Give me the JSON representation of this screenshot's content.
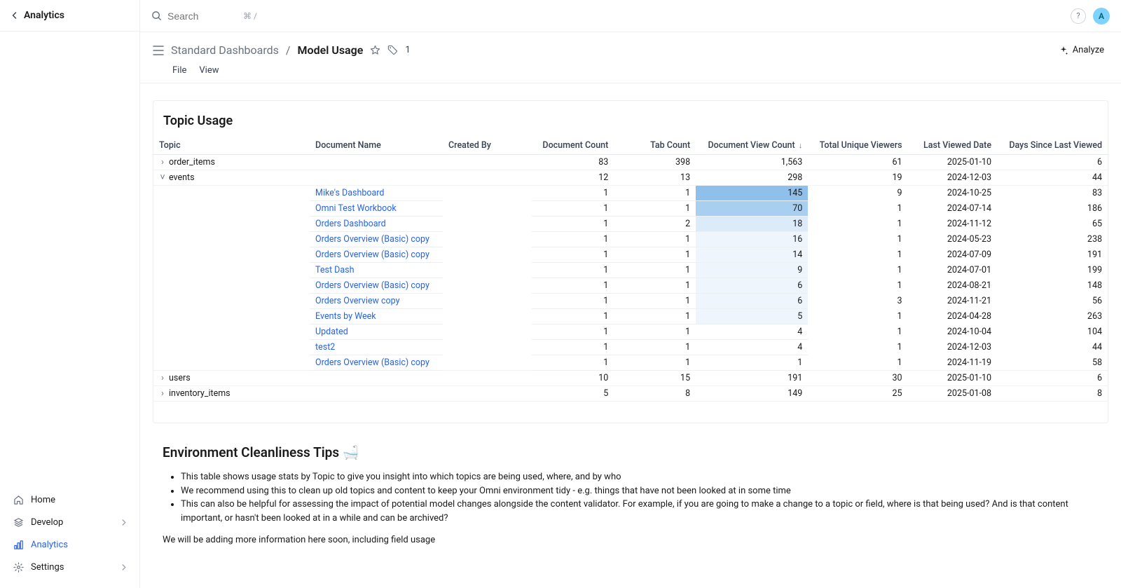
{
  "sidebar": {
    "title": "Analytics",
    "nav": [
      {
        "id": "home",
        "label": "Home",
        "icon": "home-icon"
      },
      {
        "id": "develop",
        "label": "Develop",
        "icon": "layers-icon",
        "chevron": true
      },
      {
        "id": "analytics",
        "label": "Analytics",
        "icon": "bar-chart-icon",
        "active": true
      },
      {
        "id": "settings",
        "label": "Settings",
        "icon": "gear-icon",
        "chevron": true
      }
    ]
  },
  "topbar": {
    "search_placeholder": "Search",
    "kbd": "⌘ /",
    "avatar_initial": "A"
  },
  "header": {
    "breadcrumb_parent": "Standard Dashboards",
    "breadcrumb_current": "Model Usage",
    "tag_count": "1",
    "menu": {
      "file": "File",
      "view": "View"
    },
    "analyze_label": "Analyze"
  },
  "card": {
    "title": "Topic Usage",
    "columns": {
      "topic": "Topic",
      "doc_name": "Document Name",
      "created_by": "Created By",
      "doc_count": "Document Count",
      "tab_count": "Tab Count",
      "view_count": "Document View Count",
      "viewers": "Total Unique Viewers",
      "last_viewed": "Last Viewed Date",
      "days_since": "Days Since Last Viewed"
    },
    "sort_indicator": "↓"
  },
  "chart_data": {
    "type": "table",
    "groups": [
      {
        "topic": "order_items",
        "expanded": false,
        "doc_count": 83,
        "tab_count": 398,
        "view_count": "1,563",
        "viewers": 61,
        "last_viewed": "2025-01-10",
        "days_since": 6
      },
      {
        "topic": "events",
        "expanded": true,
        "doc_count": 12,
        "tab_count": 13,
        "view_count": 298,
        "viewers": 19,
        "last_viewed": "2024-12-03",
        "days_since": 44,
        "rows": [
          {
            "doc": "Mike's Dashboard",
            "doc_count": 1,
            "tab_count": 1,
            "view_count": 145,
            "heat": 5,
            "viewers": 9,
            "last_viewed": "2024-10-25",
            "days_since": 83
          },
          {
            "doc": "Omni Test Workbook",
            "doc_count": 1,
            "tab_count": 1,
            "view_count": 70,
            "heat": 4,
            "viewers": 1,
            "last_viewed": "2024-07-14",
            "days_since": 186
          },
          {
            "doc": "Orders Dashboard",
            "doc_count": 1,
            "tab_count": 2,
            "view_count": 18,
            "heat": 2,
            "viewers": 1,
            "last_viewed": "2024-11-12",
            "days_since": 65
          },
          {
            "doc": "Orders Overview (Basic) copy",
            "doc_count": 1,
            "tab_count": 1,
            "view_count": 16,
            "heat": 1,
            "viewers": 1,
            "last_viewed": "2024-05-23",
            "days_since": 238
          },
          {
            "doc": "Orders Overview (Basic) copy",
            "doc_count": 1,
            "tab_count": 1,
            "view_count": 14,
            "heat": 1,
            "viewers": 1,
            "last_viewed": "2024-07-09",
            "days_since": 191
          },
          {
            "doc": "Test Dash",
            "doc_count": 1,
            "tab_count": 1,
            "view_count": 9,
            "heat": 1,
            "viewers": 1,
            "last_viewed": "2024-07-01",
            "days_since": 199
          },
          {
            "doc": "Orders Overview (Basic) copy",
            "doc_count": 1,
            "tab_count": 1,
            "view_count": 6,
            "heat": 1,
            "viewers": 1,
            "last_viewed": "2024-08-21",
            "days_since": 148
          },
          {
            "doc": "Orders Overview copy",
            "doc_count": 1,
            "tab_count": 1,
            "view_count": 6,
            "heat": 1,
            "viewers": 3,
            "last_viewed": "2024-11-21",
            "days_since": 56
          },
          {
            "doc": "Events by Week",
            "doc_count": 1,
            "tab_count": 1,
            "view_count": 5,
            "heat": 1,
            "viewers": 1,
            "last_viewed": "2024-04-28",
            "days_since": 263
          },
          {
            "doc": "Updated",
            "doc_count": 1,
            "tab_count": 1,
            "view_count": 4,
            "heat": 0,
            "viewers": 1,
            "last_viewed": "2024-10-04",
            "days_since": 104
          },
          {
            "doc": "test2",
            "doc_count": 1,
            "tab_count": 1,
            "view_count": 4,
            "heat": 0,
            "viewers": 1,
            "last_viewed": "2024-12-03",
            "days_since": 44
          },
          {
            "doc": "Orders Overview (Basic) copy",
            "doc_count": 1,
            "tab_count": 1,
            "view_count": 1,
            "heat": 0,
            "viewers": 1,
            "last_viewed": "2024-11-19",
            "days_since": 58
          }
        ]
      },
      {
        "topic": "users",
        "expanded": false,
        "doc_count": 10,
        "tab_count": 15,
        "view_count": 191,
        "viewers": 30,
        "last_viewed": "2025-01-10",
        "days_since": 6
      },
      {
        "topic": "inventory_items",
        "expanded": false,
        "doc_count": 5,
        "tab_count": 8,
        "view_count": 149,
        "viewers": 25,
        "last_viewed": "2025-01-08",
        "days_since": 8
      }
    ]
  },
  "tips": {
    "heading": "Environment Cleanliness Tips 🛁",
    "bullets": [
      "This table shows usage stats by Topic to give you insight into which topics are being used, where, and by who",
      "We recommend using this to clean up old topics and content to keep your Omni environment tidy - e.g. things that have not been looked at in some time",
      "This can also be helpful for assessing the impact of potential model changes alongside the content validator. For example, if you are going to make a change to a topic or field, where is that being used? And is that content important, or hasn't been looked at in a while and can be archived?"
    ],
    "footer": "We will be adding more information here soon, including field usage"
  }
}
